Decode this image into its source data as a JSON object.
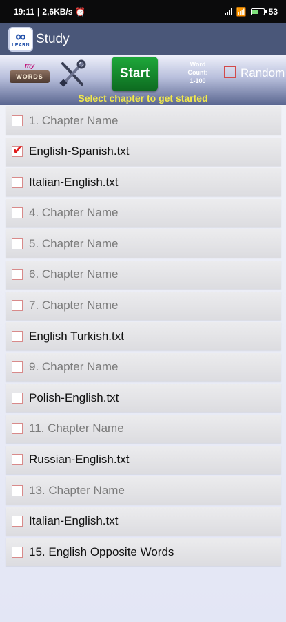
{
  "status": {
    "time": "19:11",
    "speed": "2,6KB/s",
    "battery": "53"
  },
  "appbar": {
    "logo_text": "LEARN",
    "title": "Study"
  },
  "toolbar": {
    "my_label": "my",
    "words_label": "WORDS",
    "start_label": "Start",
    "word_count_label": "Word\nCount:",
    "word_count_value": "1-100",
    "random_label": "Random",
    "hint": "Select chapter to get started"
  },
  "chapters": [
    {
      "label": "1. Chapter Name",
      "checked": false,
      "placeholder": true
    },
    {
      "label": "English-Spanish.txt",
      "checked": true,
      "placeholder": false
    },
    {
      "label": "Italian-English.txt",
      "checked": false,
      "placeholder": false
    },
    {
      "label": "4. Chapter Name",
      "checked": false,
      "placeholder": true
    },
    {
      "label": "5. Chapter Name",
      "checked": false,
      "placeholder": true
    },
    {
      "label": "6. Chapter Name",
      "checked": false,
      "placeholder": true
    },
    {
      "label": "7. Chapter Name",
      "checked": false,
      "placeholder": true
    },
    {
      "label": "English Turkish.txt",
      "checked": false,
      "placeholder": false
    },
    {
      "label": "9. Chapter Name",
      "checked": false,
      "placeholder": true
    },
    {
      "label": "Polish-English.txt",
      "checked": false,
      "placeholder": false
    },
    {
      "label": "11. Chapter Name",
      "checked": false,
      "placeholder": true
    },
    {
      "label": "Russian-English.txt",
      "checked": false,
      "placeholder": false
    },
    {
      "label": "13. Chapter Name",
      "checked": false,
      "placeholder": true
    },
    {
      "label": "Italian-English.txt",
      "checked": false,
      "placeholder": false
    },
    {
      "label": "15. English Opposite Words",
      "checked": false,
      "placeholder": false
    }
  ]
}
